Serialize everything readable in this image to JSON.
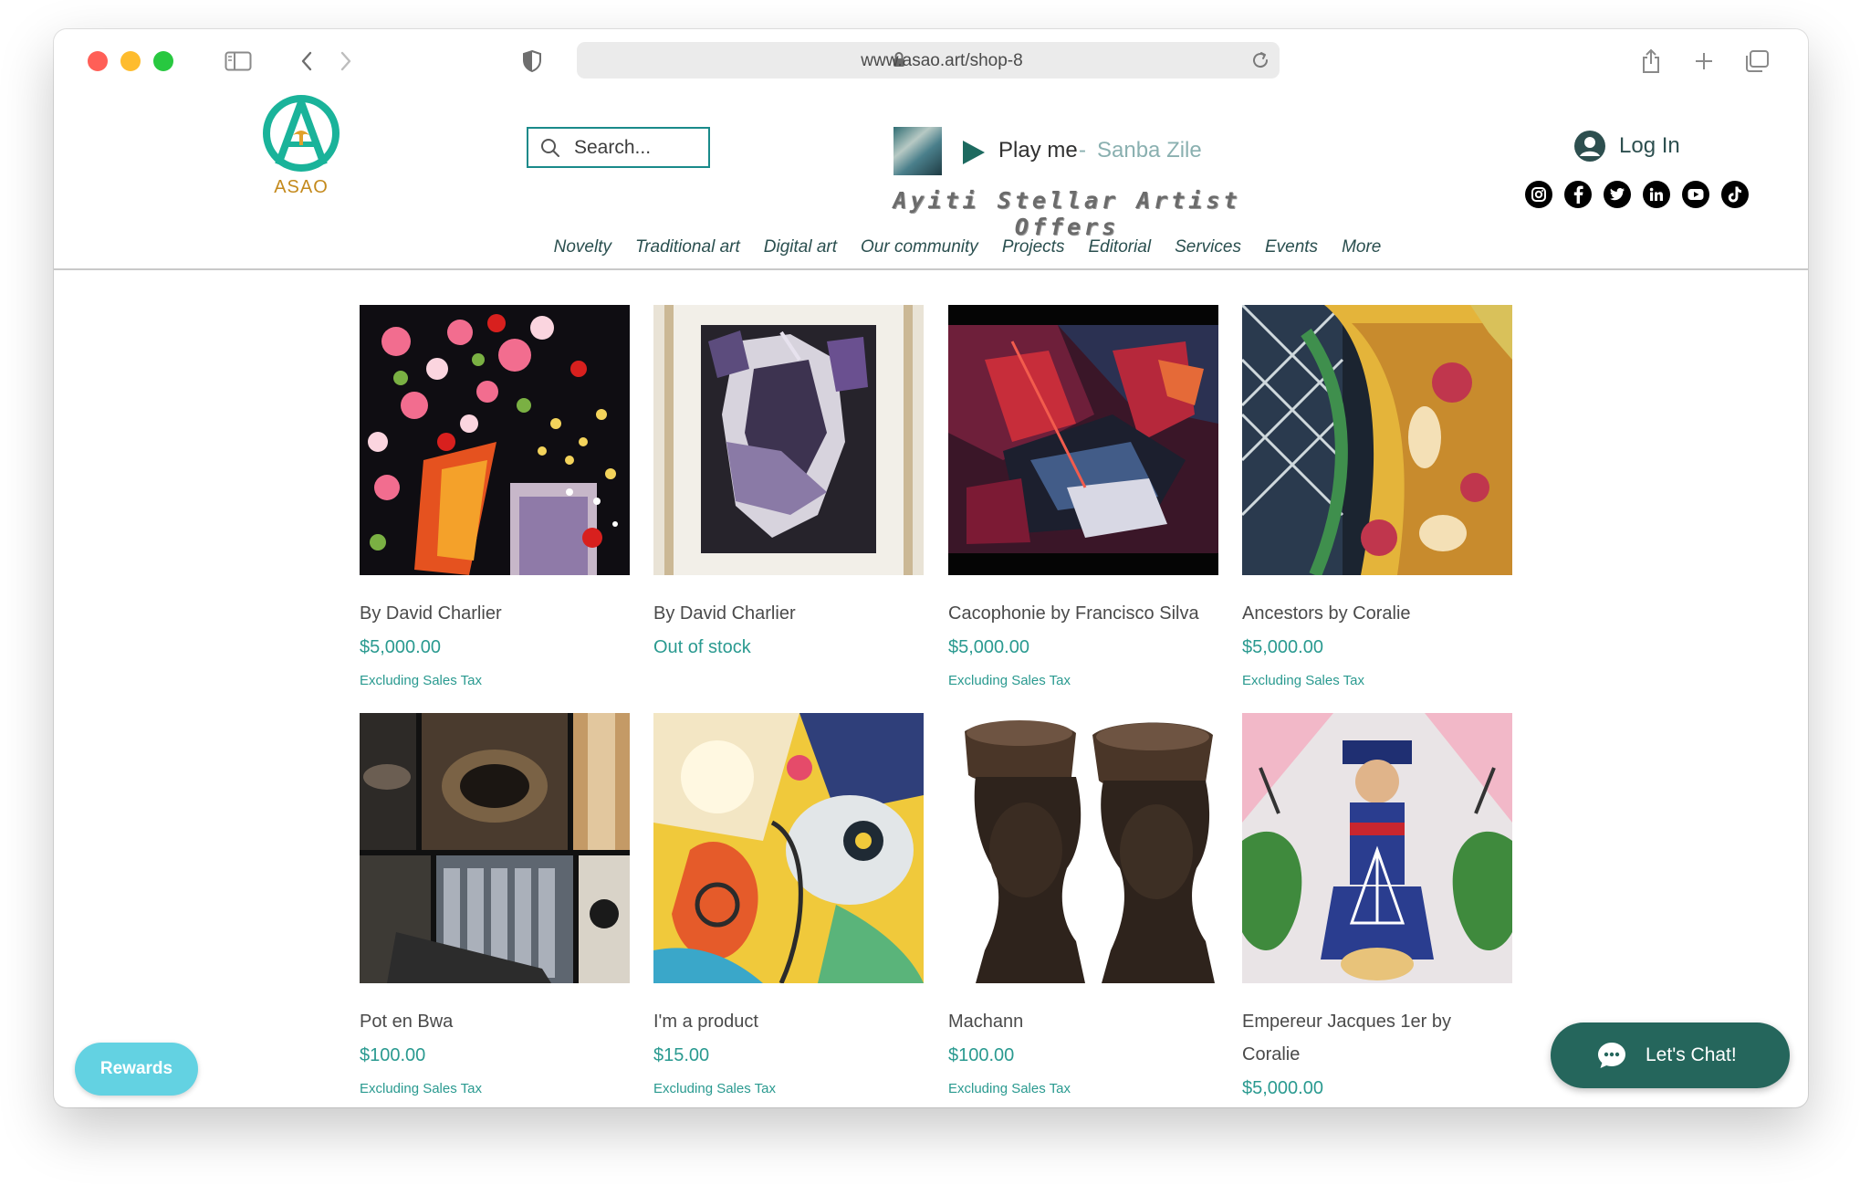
{
  "browser": {
    "url": "www.asao.art/shop-8"
  },
  "site": {
    "logo_text": "ASAO",
    "brand_color": "#1ab39a",
    "accent_color": "#c48a1d"
  },
  "search": {
    "placeholder": "Search..."
  },
  "player": {
    "label": "Play me",
    "separator": "-",
    "song": "Sanba Zile"
  },
  "tagline": "Ayiti Stellar Artist Offers",
  "account": {
    "login_label": "Log In"
  },
  "socials": [
    "instagram-icon",
    "facebook-icon",
    "twitter-icon",
    "linkedin-icon",
    "youtube-icon",
    "tiktok-icon"
  ],
  "nav": {
    "items": [
      "Novelty",
      "Traditional art",
      "Digital art",
      "Our community",
      "Projects",
      "Editorial",
      "Services",
      "Events",
      "More"
    ]
  },
  "products": [
    {
      "name": "By David Charlier",
      "price": "$5,000.00",
      "tax": "Excluding Sales Tax"
    },
    {
      "name": "By David Charlier",
      "stock": "Out of stock"
    },
    {
      "name": "Cacophonie by Francisco Silva",
      "price": "$5,000.00",
      "tax": "Excluding Sales Tax"
    },
    {
      "name": "Ancestors by Coralie",
      "price": "$5,000.00",
      "tax": "Excluding Sales Tax"
    },
    {
      "name": "Pot en Bwa",
      "price": "$100.00",
      "tax": "Excluding Sales Tax"
    },
    {
      "name": "I'm a product",
      "price": "$15.00",
      "tax": "Excluding Sales Tax"
    },
    {
      "name": "Machann",
      "price": "$100.00",
      "tax": "Excluding Sales Tax"
    },
    {
      "name_line1": "Empereur Jacques 1er by",
      "name_line2": "Coralie",
      "price": "$5,000.00"
    }
  ],
  "rewards": {
    "label": "Rewards"
  },
  "chat": {
    "label": "Let's Chat!"
  }
}
